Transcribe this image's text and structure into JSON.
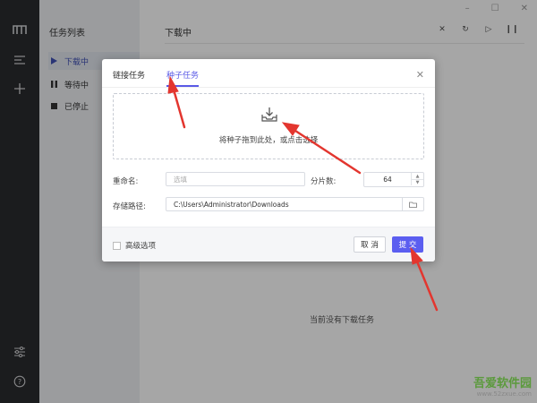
{
  "sidebar": {
    "title": "任务列表",
    "items": [
      {
        "label": "下载中",
        "active": true
      },
      {
        "label": "等待中",
        "active": false
      },
      {
        "label": "已停止",
        "active": false
      }
    ]
  },
  "main": {
    "title": "下载中",
    "empty_text": "当前没有下载任务"
  },
  "dialog": {
    "tabs": [
      {
        "label": "链接任务",
        "active": false
      },
      {
        "label": "种子任务",
        "active": true
      }
    ],
    "drop_text": "将种子拖到此处，或点击选择",
    "rename_label": "重命名:",
    "rename_placeholder": "选填",
    "split_label": "分片数:",
    "split_value": "64",
    "path_label": "存储路径:",
    "path_value": "C:\\Users\\Administrator\\Downloads",
    "advanced_label": "高级选项",
    "cancel_label": "取 消",
    "submit_label": "提 交"
  },
  "watermark": {
    "name": "吾爱软件园",
    "url": "www.52zxue.com"
  },
  "colors": {
    "accent": "#5b5ef0",
    "rail": "#2a2b2e",
    "arrow": "#e3362f"
  }
}
